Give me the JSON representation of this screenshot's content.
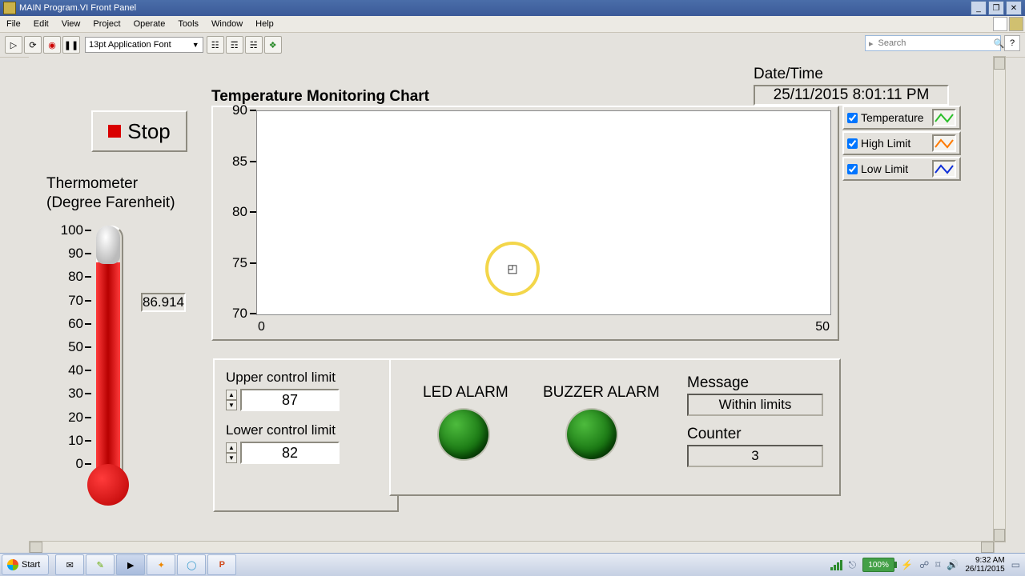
{
  "window": {
    "title": "MAIN Program.VI Front Panel"
  },
  "menu": {
    "items": [
      "File",
      "Edit",
      "View",
      "Project",
      "Operate",
      "Tools",
      "Window",
      "Help"
    ]
  },
  "toolbar": {
    "font": "13pt Application Font",
    "search_placeholder": "Search",
    "help": "?"
  },
  "stop": {
    "label": "Stop"
  },
  "thermometer": {
    "title_l1": "Thermometer",
    "title_l2": "(Degree Farenheit)",
    "min": 0,
    "max": 100,
    "ticks": [
      100,
      90,
      80,
      70,
      60,
      50,
      40,
      30,
      20,
      10,
      0
    ],
    "value": 86.914,
    "readout": "86.914"
  },
  "datetime": {
    "label": "Date/Time",
    "value": "25/11/2015 8:01:11 PM"
  },
  "chart_title": "Temperature Monitoring Chart",
  "chart_data": {
    "type": "line",
    "title": "Temperature Monitoring Chart",
    "x": [
      0,
      50
    ],
    "xlabel": "",
    "ylabel": "",
    "xlim": [
      0,
      50
    ],
    "ylim": [
      70,
      90
    ],
    "yticks": [
      70,
      75,
      80,
      85,
      90
    ],
    "xticks": [
      0,
      50
    ],
    "series": [
      {
        "name": "Temperature",
        "color": "#2bbf2b",
        "values": []
      },
      {
        "name": "High Limit",
        "color": "#ff7a00",
        "values": []
      },
      {
        "name": "Low Limit",
        "color": "#1030d8",
        "values": []
      }
    ]
  },
  "legend": {
    "items": [
      {
        "label": "Temperature",
        "checked": true,
        "color": "#2bbf2b"
      },
      {
        "label": "High Limit",
        "checked": true,
        "color": "#ff7a00"
      },
      {
        "label": "Low Limit",
        "checked": true,
        "color": "#1030d8"
      }
    ]
  },
  "limits": {
    "upper_label": "Upper control limit",
    "upper_value": "87",
    "lower_label": "Lower control limit",
    "lower_value": "82"
  },
  "alarms": {
    "led_label": "LED ALARM",
    "buzzer_label": "BUZZER ALARM",
    "message_label": "Message",
    "message_value": "Within limits",
    "counter_label": "Counter",
    "counter_value": "3"
  },
  "taskbar": {
    "start": "Start",
    "battery": "100%",
    "clock_time": "9:32 AM",
    "clock_date": "26/11/2015"
  }
}
